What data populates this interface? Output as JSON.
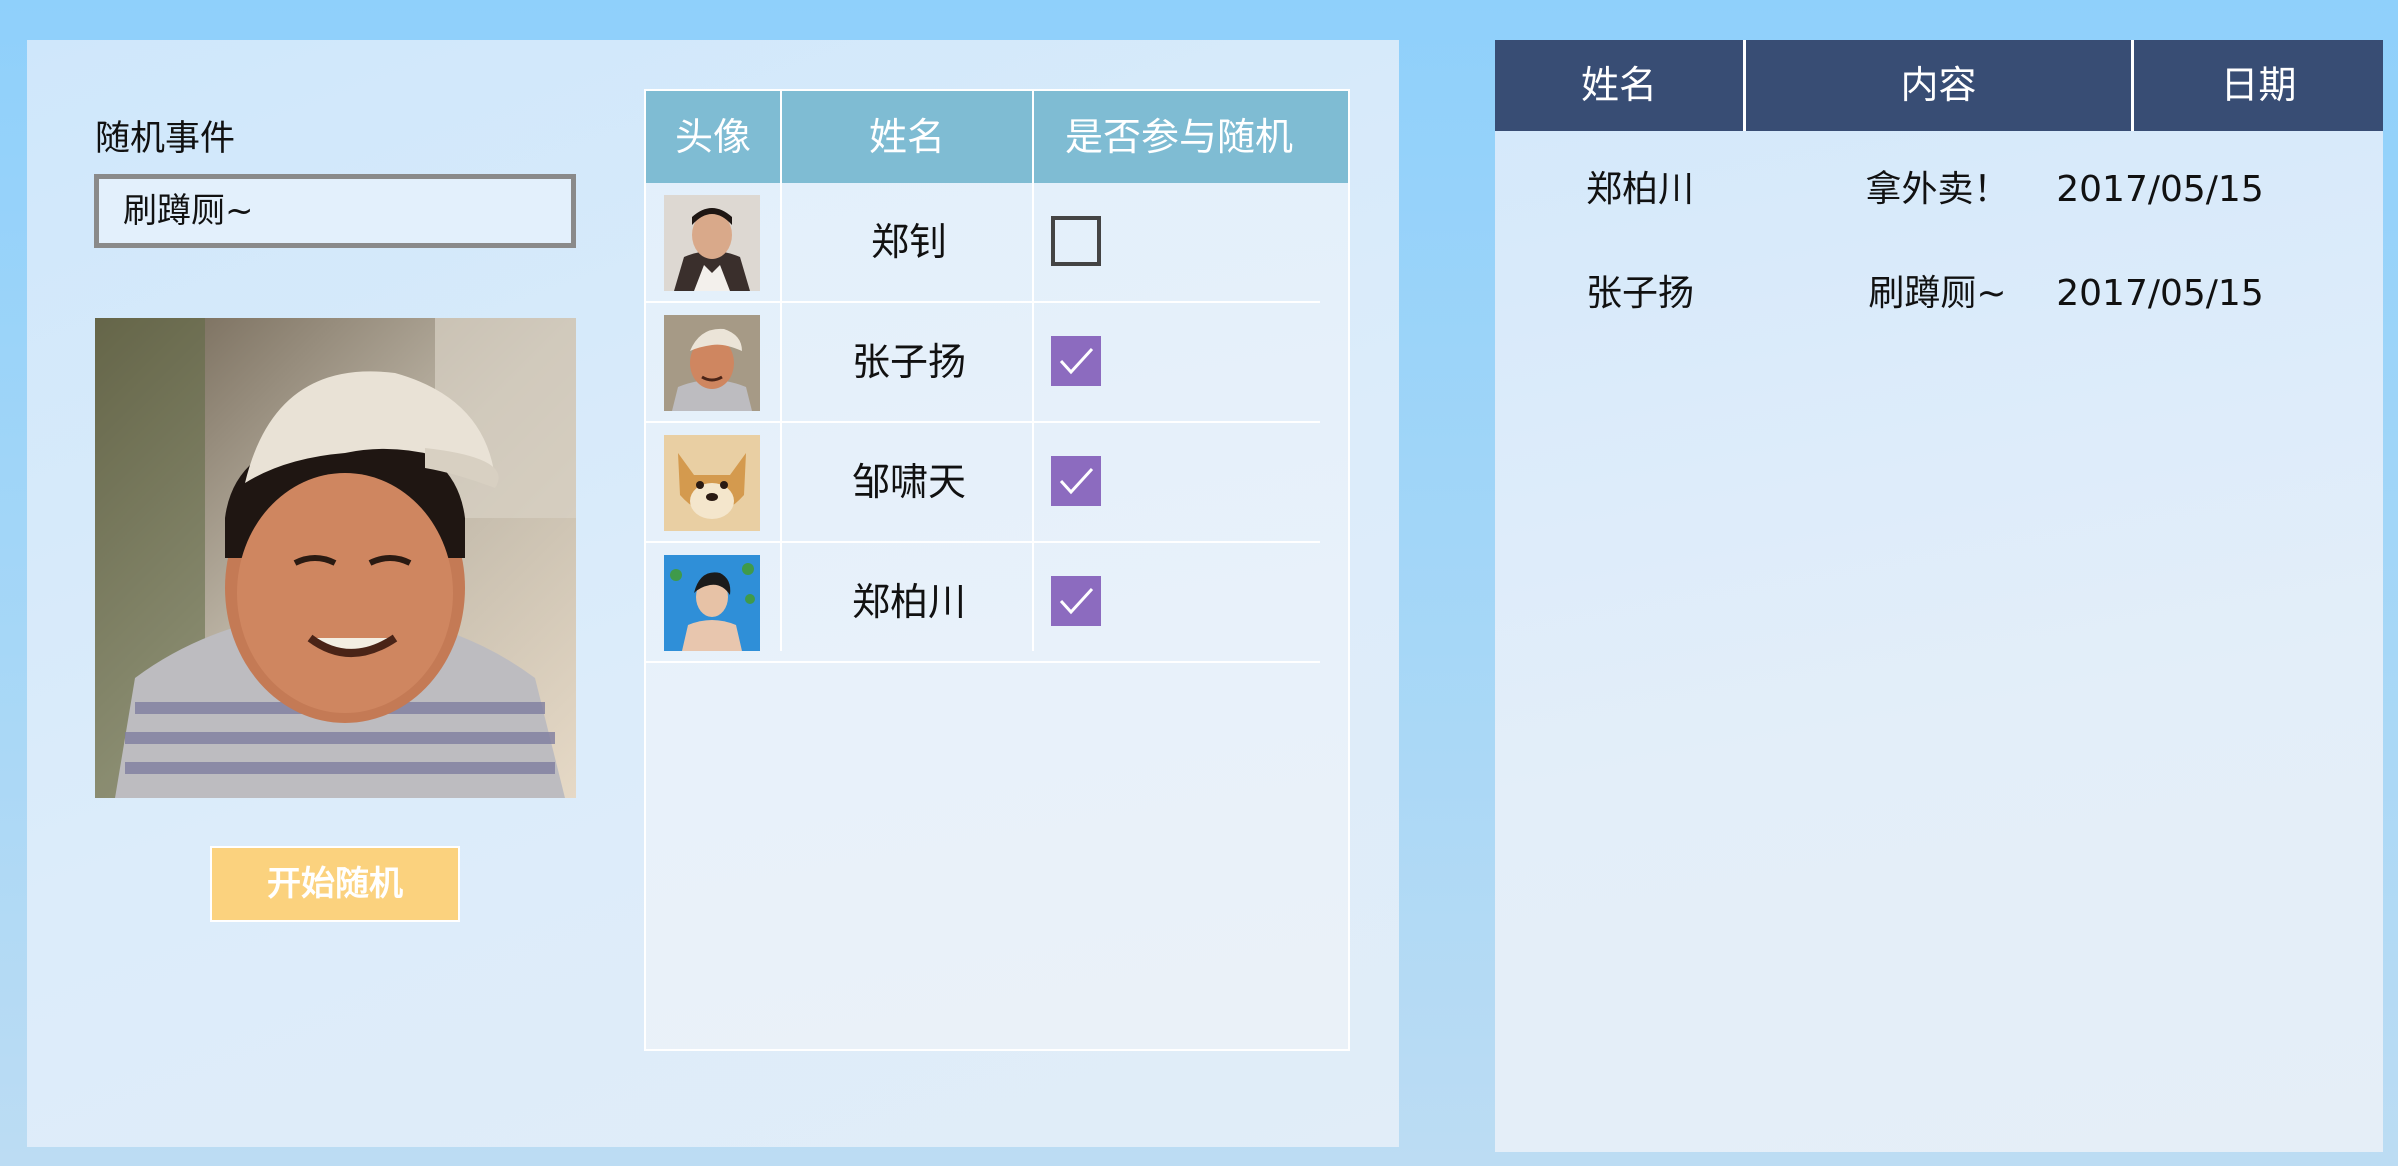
{
  "left_panel": {
    "event_label": "随机事件",
    "event_input_value": "刷蹲厕~",
    "start_button_label": "开始随机",
    "start_button_color": "#fbd27e"
  },
  "participants": {
    "header_color": "#7fbcd3",
    "columns": [
      "头像",
      "姓名",
      "是否参与随机"
    ],
    "rows": [
      {
        "name": "郑钊",
        "checked": false
      },
      {
        "name": "张子扬",
        "checked": true
      },
      {
        "name": "邹啸天",
        "checked": true
      },
      {
        "name": "郑柏川",
        "checked": true
      }
    ],
    "checkbox_color": "#8c6bbf"
  },
  "history": {
    "header_color": "#384d74",
    "columns": [
      "姓名",
      "内容",
      "日期"
    ],
    "rows": [
      {
        "name": "郑柏川",
        "content": "拿外卖！",
        "date": "2017/05/15"
      },
      {
        "name": "张子扬",
        "content": "刷蹲厕~",
        "date": "2017/05/15"
      }
    ]
  }
}
